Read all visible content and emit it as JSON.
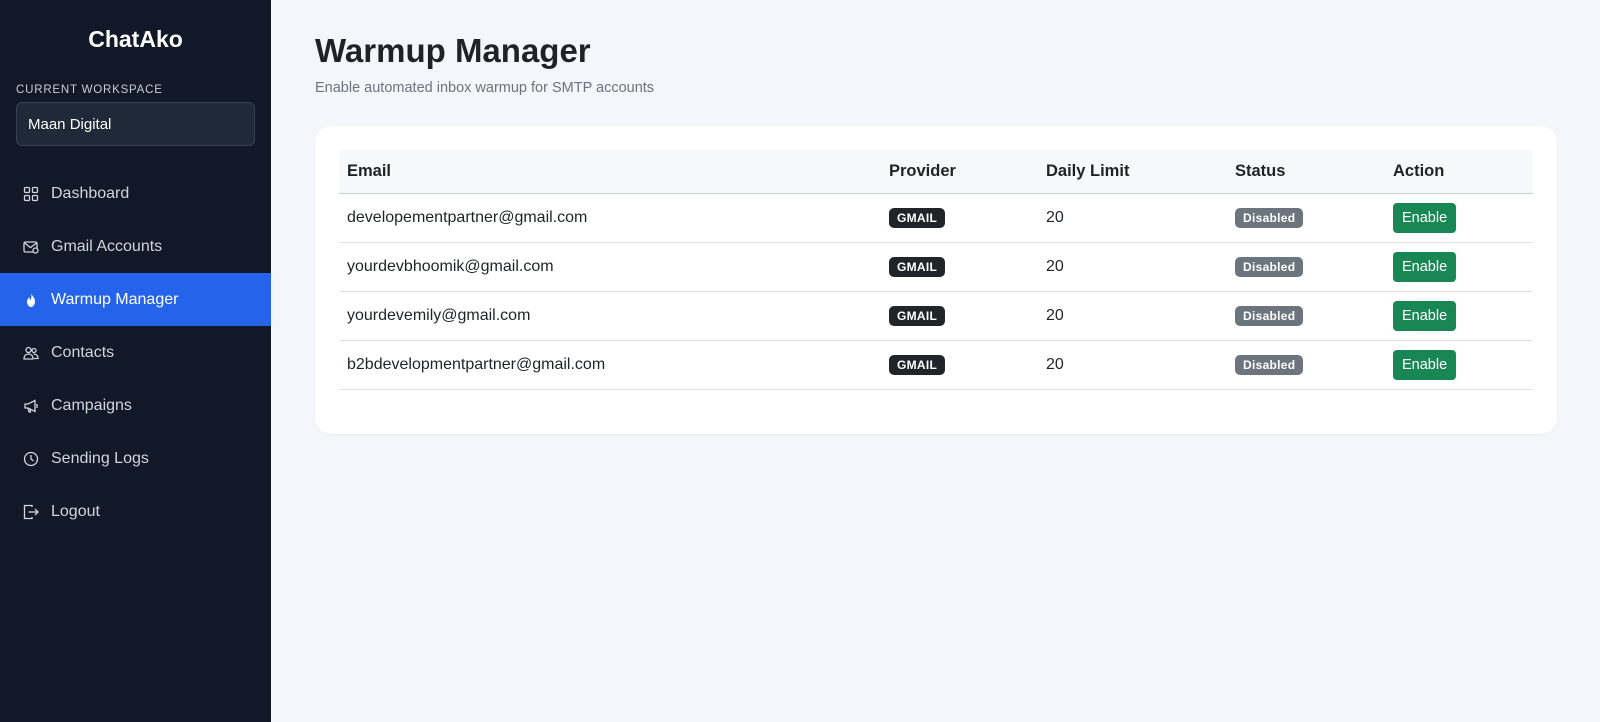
{
  "brand": "ChatAko",
  "workspace": {
    "label": "CURRENT WORKSPACE",
    "value": "Maan Digital"
  },
  "nav": [
    {
      "label": "Dashboard",
      "icon": "grid-icon",
      "active": false
    },
    {
      "label": "Gmail Accounts",
      "icon": "mail-icon",
      "active": false
    },
    {
      "label": "Warmup Manager",
      "icon": "flame-icon",
      "active": true
    },
    {
      "label": "Contacts",
      "icon": "people-icon",
      "active": false
    },
    {
      "label": "Campaigns",
      "icon": "megaphone-icon",
      "active": false
    },
    {
      "label": "Sending Logs",
      "icon": "clock-icon",
      "active": false
    },
    {
      "label": "Logout",
      "icon": "logout-icon",
      "active": false
    }
  ],
  "page": {
    "title": "Warmup Manager",
    "subtitle": "Enable automated inbox warmup for SMTP accounts"
  },
  "table": {
    "headers": {
      "email": "Email",
      "provider": "Provider",
      "limit": "Daily Limit",
      "status": "Status",
      "action": "Action"
    },
    "rows": [
      {
        "email": "developementpartner@gmail.com",
        "provider": "GMAIL",
        "limit": "20",
        "status": "Disabled",
        "action": "Enable"
      },
      {
        "email": "yourdevbhoomik@gmail.com",
        "provider": "GMAIL",
        "limit": "20",
        "status": "Disabled",
        "action": "Enable"
      },
      {
        "email": "yourdevemily@gmail.com",
        "provider": "GMAIL",
        "limit": "20",
        "status": "Disabled",
        "action": "Enable"
      },
      {
        "email": "b2bdevelopmentpartner@gmail.com",
        "provider": "GMAIL",
        "limit": "20",
        "status": "Disabled",
        "action": "Enable"
      }
    ]
  },
  "colors": {
    "sidebar_bg": "#111827",
    "active_nav": "#2563eb",
    "enable_button": "#198754",
    "provider_badge": "#212529",
    "status_badge": "#6c757d"
  }
}
